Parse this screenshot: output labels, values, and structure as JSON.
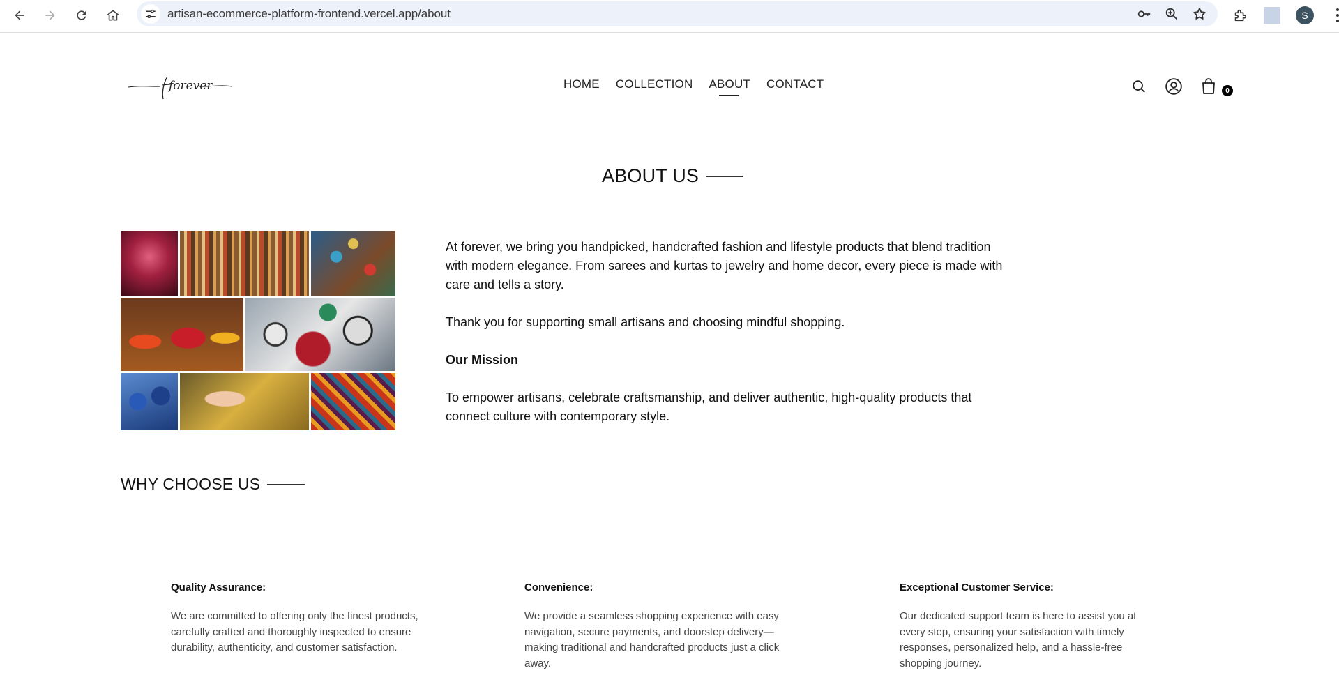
{
  "browser": {
    "url": "artisan-ecommerce-platform-frontend.vercel.app/about",
    "profile_initial": "S",
    "icons": [
      "back-icon",
      "forward-icon",
      "reload-icon",
      "home-icon",
      "tune-icon",
      "password-key-icon",
      "zoom-icon",
      "bookmark-star-icon",
      "extensions-icon",
      "menu-dots-icon"
    ]
  },
  "header": {
    "logo_text": "forever",
    "nav": [
      {
        "label": "HOME",
        "active": false
      },
      {
        "label": "COLLECTION",
        "active": false
      },
      {
        "label": "ABOUT",
        "active": true
      },
      {
        "label": "CONTACT",
        "active": false
      }
    ],
    "cart_count": "0",
    "icons": [
      "search-icon",
      "profile-icon",
      "cart-icon"
    ]
  },
  "about": {
    "title": "ABOUT US",
    "paragraph1": "At forever, we bring you handpicked, handcrafted fashion and lifestyle products that blend tradition with modern elegance. From sarees and kurtas to jewelry and home decor, every piece is made with care and tells a story.",
    "paragraph2": "Thank you for supporting small artisans and choosing mindful shopping.",
    "mission_heading": "Our Mission",
    "mission_text": "To empower artisans, celebrate craftsmanship, and deliver authentic, high-quality products that connect culture with contemporary style."
  },
  "why": {
    "title": "WHY CHOOSE US",
    "features": [
      {
        "title": "Quality Assurance:",
        "text": "We are committed to offering only the finest products, carefully crafted and thoroughly inspected to ensure durability, authenticity, and customer satisfaction."
      },
      {
        "title": "Convenience:",
        "text": "We provide a seamless shopping experience with easy navigation, secure payments, and doorstep delivery—making traditional and handcrafted products just a click away."
      },
      {
        "title": "Exceptional Customer Service:",
        "text": "Our dedicated support team is here to assist you at every step, ensuring your satisfaction with timely responses, personalized help, and a hassle-free shopping journey."
      }
    ]
  }
}
